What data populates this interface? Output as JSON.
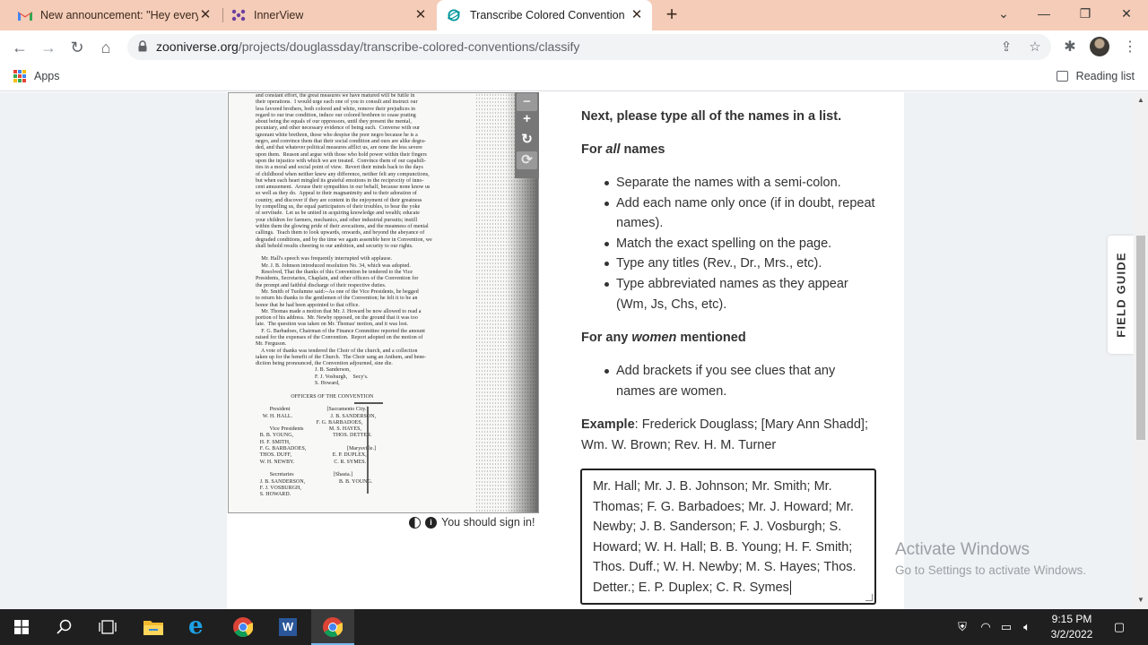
{
  "browser": {
    "tabs": [
      {
        "title": "New announcement: \"Hey everyo",
        "favicon": "gmail-icon"
      },
      {
        "title": "InnerView",
        "favicon": "innerview-icon"
      },
      {
        "title": "Transcribe Colored Conventions",
        "favicon": "zooniverse-icon"
      }
    ],
    "url_domain": "zooniverse.org",
    "url_path": "/projects/douglassday/transcribe-colored-conventions/classify",
    "bookmarks": {
      "apps": "Apps",
      "reading_list": "Reading list"
    }
  },
  "subject": {
    "scan_lines": [
      "and constant effort, the great measures we have matured will be futile in",
      "their operations.  I would urge each one of you to consult and instruct our",
      "less favored brothers, both colored and white, remove their prejudices in",
      "regard to our true condition, induce our colored brethren to cease prating",
      "about being the equals of our oppressors, until they present the mental,",
      "pecuniary, and other necessary evidence of being such.  Converse with our",
      "ignorant white brethren, those who despise the poor negro because he is a",
      "negro, and convince them that their social condition and ours are alike degra-",
      "ded, and that whatever political measures afflict us, are none the less severe",
      "upon them.  Reason and argue with those who hold power within their fingers",
      "upon the injustice with which we are treated.  Convince them of our capabili-",
      "ties in a moral and social point of view.  Revert their minds back to the days",
      "of childhood when neither knew any difference, neither felt any compunctions,",
      "but when each heart mingled its grateful emotions in the reciprocity of inno-",
      "cent amusement.  Arouse their sympathies in our behalf, because none know us",
      "so well as they do.  Appeal to their magnanimity and to their adoration of",
      "country, and discover if they are content in the enjoyment of their greatness",
      "by compelling us, the equal participators of their troubles, to bear the yoke",
      "of servitude.  Let us be united in acquiring knowledge and wealth; educate",
      "your children for farmers, mechanics, and other industrial pursuits; instill",
      "within them the glowing pride of their avocations, and the meanness of menial",
      "callings.  Teach them to look upwards, onwards, and beyond the abeyance of",
      "degraded conditions, and by the time we again assemble here in Convention, we",
      "shall behold results cheering to our ambition, and security to our rights.",
      "",
      "    Mr. Hall's speech was frequently interrupted with applause.",
      "    Mr. J. B. Johnson introduced resolution No. 34, which was adopted.",
      "    Resolved, That the thanks of this Convention be tendered to the Vice",
      "Presidents, Secretaries, Chaplain, and other officers of the Convention for",
      "the prompt and faithful discharge of their respective duties.",
      "    Mr. Smith of Tuolumne said:--As one of the Vice Presidents, he begged",
      "to return his thanks to the gentlemen of the Convention; he felt it to be an",
      "honor that he had been appointed to that office.",
      "    Mr. Thomas made a motion that Mr. J. Howard be now allowed to read a",
      "portion of his address.  Mr. Newby opposed, on the ground that it was too",
      "late.  The question was taken on Mr. Thomas' motion, and it was lost.",
      "    F. G. Barbadoes, Chairman of the Finance Committee reported the amount",
      "raised for the expenses of the Convention.  Report adopted on the motion of",
      "Mr. Ferguson.",
      "    A vote of thanks was tendered the Choir of the church, and a collection",
      "taken up for the benefit of the Church.  The Choir sang an Anthem, and bene-",
      "diction being pronounced, the Convention adjourned, sine die.",
      "                                          J. B. Sanderson,",
      "                                          F. J. Vosburgh,    Secy's.",
      "                                          S. Howard,",
      "",
      "                         OFFICERS OF THE CONVENTION",
      "",
      "          President                          [Sacramento City.]",
      "     W. H. HALL.                           J. B. SANDERSON,",
      "                                           F. G. BARBADOES,",
      "          Vice Presidents                  M. S. HAYES,",
      "   B. B. YOUNG,                            THOS. DETTER.",
      "   H. F. SMITH,",
      "   F. G. BARBADOES,                             [Marysville.]",
      "   THOS. DUFF,                             E. P. DUPLEX,",
      "   W. H. NEWBY.                            C. R. SYMES.",
      "",
      "          Secretaries                            [Shasta.]",
      "   J. B. SANDERSON,                        B. B. YOUNG.",
      "   F. J. VOSBURGH,",
      "   S. HOWARD."
    ],
    "sign_in": "You should sign in!"
  },
  "task": {
    "question": "Next, please type all of the names in a list.",
    "all_names_heading_pre": "For ",
    "all_names_heading_em": "all",
    "all_names_heading_post": " names",
    "all_names_rules": [
      "Separate the names with a semi-colon.",
      "Add each name only once (if in doubt, repeat names).",
      "Match the exact spelling on the page.",
      "Type any titles (Rev., Dr., Mrs., etc).",
      "Type abbreviated names as they appear (Wm, Js, Chs, etc)."
    ],
    "women_heading_pre": "For any ",
    "women_heading_em": "women",
    "women_heading_post": " mentioned",
    "women_rules": [
      "Add brackets if you see clues that any names are women."
    ],
    "example_label": "Example",
    "example_text": ": Frederick Douglass; [Mary Ann Shadd]; Wm. W. Brown; Rev. H. M. Turner",
    "answer_value": "Mr. Hall; Mr. J. B. Johnson; Mr. Smith; Mr. Thomas; F. G. Barbadoes; Mr. J. Howard; Mr. Newby; J. B. Sanderson; F. J. Vosburgh; S. Howard; W. H. Hall; B. B. Young; H. F. Smith; Thos. Duff.; W. H. Newby; M. S. Hayes; Thos. Detter.; E. P. Duplex; C. R. Symes"
  },
  "field_guide": "FIELD GUIDE",
  "watermark": {
    "line1": "Activate Windows",
    "line2": "Go to Settings to activate Windows."
  },
  "taskbar": {
    "time": "9:15 PM",
    "date": "3/2/2022"
  },
  "colors": {
    "tab_strip": "#f4ccb7",
    "page_bg": "#eff2f5",
    "taskbar": "#1f1f1f"
  }
}
